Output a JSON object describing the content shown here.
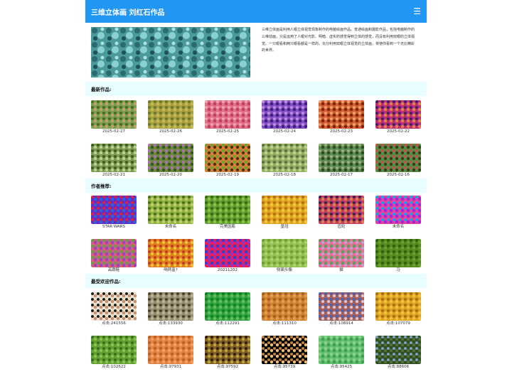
{
  "header": {
    "title": "三维立体画 刘红石作品",
    "menu_icon": "hamburger-menu-icon"
  },
  "intro": {
    "text": "三维立体画是利用人眼立体视觉现象制作的电脑绘画作品。普通绘画和摄影作品，包括电脑制作的三维动画，只是运用了人眼对光影、明暗、虚实的感觉得到立体的感觉，而没有利用双眼的立体视觉。一只眼看和两只眼看都是一样的。充分利用双眼立体视觉的立体画，将使你看到一个无比精彩的世界。"
  },
  "sections": [
    {
      "title": "最新作品:",
      "items": [
        {
          "label": "2025-02-27",
          "colors": [
            "#7aa04a",
            "#4a6a2a",
            "#c0a070"
          ]
        },
        {
          "label": "2025-02-26",
          "colors": [
            "#a8a040",
            "#6a7a2a",
            "#c8b860"
          ]
        },
        {
          "label": "2025-02-25",
          "colors": [
            "#e07088",
            "#f0a0b0",
            "#c04060"
          ]
        },
        {
          "label": "2025-02-24",
          "colors": [
            "#8050c0",
            "#c090e0",
            "#402080"
          ]
        },
        {
          "label": "2025-02-23",
          "colors": [
            "#d06030",
            "#f0a070",
            "#802010"
          ]
        },
        {
          "label": "2025-02-22",
          "colors": [
            "#c03070",
            "#402070",
            "#e08050"
          ]
        },
        {
          "label": "2025-02-21",
          "colors": [
            "#7a9a50",
            "#3a5a20",
            "#c0d090"
          ]
        },
        {
          "label": "2025-02-20",
          "colors": [
            "#6a8a40",
            "#b070b0",
            "#405020"
          ]
        },
        {
          "label": "2025-02-19",
          "colors": [
            "#d08030",
            "#70a040",
            "#503010"
          ]
        },
        {
          "label": "2025-02-18",
          "colors": [
            "#90b060",
            "#607040",
            "#c0d090"
          ]
        },
        {
          "label": "2025-02-17",
          "colors": [
            "#5a8a50",
            "#a0b080",
            "#304a20"
          ]
        },
        {
          "label": "2025-02-16",
          "colors": [
            "#5a8a40",
            "#c05050",
            "#304020"
          ]
        }
      ]
    },
    {
      "title": "作者推荐:",
      "items": [
        {
          "label": "STAR WARS",
          "colors": [
            "#6030c0",
            "#e02040",
            "#3060e0"
          ]
        },
        {
          "label": "未命名",
          "colors": [
            "#90b040",
            "#4a7020",
            "#c0d070"
          ]
        },
        {
          "label": "完美因瓶",
          "colors": [
            "#60a030",
            "#3a6a10",
            "#90c050"
          ]
        },
        {
          "label": "皇冠",
          "colors": [
            "#e0a020",
            "#b07010",
            "#f0c840"
          ]
        },
        {
          "label": "齿轮",
          "colors": [
            "#c04060",
            "#402050",
            "#e08050"
          ]
        },
        {
          "label": "未命名",
          "colors": [
            "#e040a0",
            "#20a0e0",
            "#a020e0"
          ]
        },
        {
          "label": "高跟鞋",
          "colors": [
            "#d06080",
            "#60a050",
            "#a040c0"
          ]
        },
        {
          "label": "喝两盅?",
          "colors": [
            "#e08020",
            "#c04020",
            "#f0c040"
          ]
        },
        {
          "label": "20211202",
          "colors": [
            "#e02060",
            "#3040e0",
            "#a030c0"
          ]
        },
        {
          "label": "侧面头像",
          "colors": [
            "#90c050",
            "#70a030",
            "#b0d070"
          ]
        },
        {
          "label": "猫",
          "colors": [
            "#e07090",
            "#50a060",
            "#c0a0d0"
          ]
        },
        {
          "label": "马",
          "colors": [
            "#508a20",
            "#306010",
            "#70a030"
          ]
        }
      ]
    },
    {
      "title": "最受欢迎作品:",
      "items": [
        {
          "label": "点击:241556",
          "colors": [
            "#f0e0d0",
            "#202020",
            "#c09070"
          ]
        },
        {
          "label": "点击:133930",
          "colors": [
            "#909070",
            "#504030",
            "#c0b090"
          ]
        },
        {
          "label": "点击:112291",
          "colors": [
            "#30a040",
            "#108020",
            "#60c060"
          ]
        },
        {
          "label": "点击:111310",
          "colors": [
            "#d08030",
            "#a06020",
            "#e0a050"
          ]
        },
        {
          "label": "点击:108914",
          "colors": [
            "#a06060",
            "#5060b0",
            "#e0c0c0"
          ]
        },
        {
          "label": "点击:107079",
          "colors": [
            "#e0a020",
            "#a07010",
            "#f0c040"
          ]
        },
        {
          "label": "点击:102622",
          "colors": [
            "#60a030",
            "#3a7020",
            "#90c050"
          ]
        },
        {
          "label": "点击:97931",
          "colors": [
            "#e08040",
            "#c06020",
            "#f0a060"
          ]
        },
        {
          "label": "点击:97592",
          "colors": [
            "#806020",
            "#302010",
            "#c0a040"
          ]
        },
        {
          "label": "点击:95739",
          "colors": [
            "#000000",
            "#c08040",
            "#f0c070"
          ]
        },
        {
          "label": "点击:95425",
          "colors": [
            "#60c070",
            "#90d090",
            "#40a050"
          ]
        },
        {
          "label": "点击:88606",
          "colors": [
            "#305020",
            "#80a0c0",
            "#507040"
          ]
        }
      ]
    }
  ]
}
